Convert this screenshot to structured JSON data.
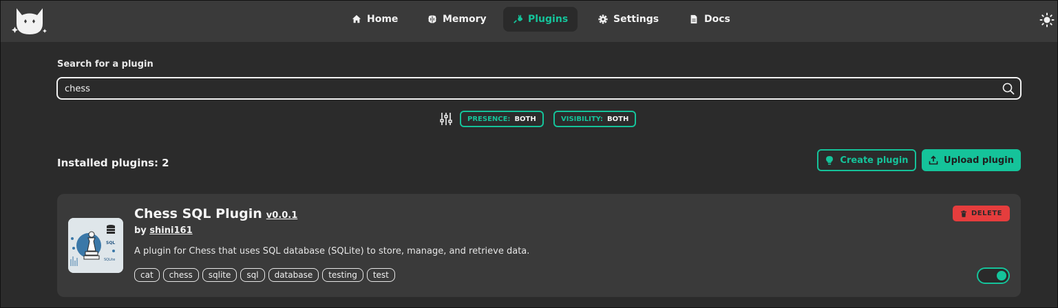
{
  "colors": {
    "accent": "#15c39a",
    "danger": "#e53d3d",
    "bg": "#2b2b2b",
    "bar": "#3a3a3a"
  },
  "nav": {
    "items": [
      {
        "label": "Home",
        "icon": "home-icon",
        "active": false
      },
      {
        "label": "Memory",
        "icon": "brain-icon",
        "active": false
      },
      {
        "label": "Plugins",
        "icon": "plug-icon",
        "active": true
      },
      {
        "label": "Settings",
        "icon": "gear-icon",
        "active": false
      },
      {
        "label": "Docs",
        "icon": "document-icon",
        "active": false
      }
    ],
    "theme_icon": "sun-icon",
    "logo_icon": "cat-logo-icon"
  },
  "search": {
    "label": "Search for a plugin",
    "value": "chess",
    "icon": "search-icon"
  },
  "filters": {
    "icon": "sliders-icon",
    "presence": {
      "key": "PRESENCE:",
      "value": "BOTH"
    },
    "visibility": {
      "key": "VISIBILITY:",
      "value": "BOTH"
    }
  },
  "installed": {
    "label": "Installed plugins: 2",
    "create_label": "Create plugin",
    "upload_label": "Upload plugin"
  },
  "plugin": {
    "name": "Chess SQL Plugin",
    "version": "v0.0.1",
    "author_prefix": "by",
    "author": "shini161",
    "description": "A plugin for Chess that uses SQL database (SQLite) to store, manage, and retrieve data.",
    "tags": [
      "cat",
      "chess",
      "sqlite",
      "sql",
      "database",
      "testing",
      "test"
    ],
    "delete_label": "DELETE",
    "enabled": true,
    "thumb_text_top": "SQL",
    "thumb_text_bottom": "SQLite"
  }
}
